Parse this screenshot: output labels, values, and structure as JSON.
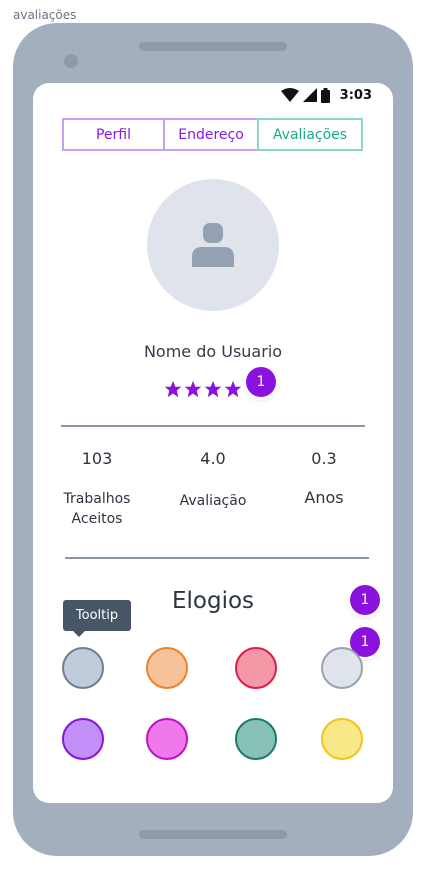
{
  "frame": {
    "label": "avaliações"
  },
  "status_bar": {
    "time": "3:03",
    "icons": [
      "wifi-icon",
      "signal-icon",
      "battery-icon"
    ]
  },
  "tabs": [
    {
      "label": "Perfil"
    },
    {
      "label": "Endereço"
    },
    {
      "label": "Avaliações",
      "active": true
    }
  ],
  "profile": {
    "avatar_icon": "user-icon",
    "name": "Nome do Usuario",
    "rating_stars": 4,
    "rating_badge": "1"
  },
  "stats": [
    {
      "value": "103",
      "label": "Trabalhos Aceitos"
    },
    {
      "value": "4.0",
      "label": "Avaliação"
    },
    {
      "value": "0.3",
      "label": "Anos"
    }
  ],
  "praise": {
    "title": "Elogios",
    "tooltip": "Tooltip",
    "badges": [
      "1",
      "1"
    ],
    "items": [
      {
        "fill": "#c0ccd9",
        "border": "#6f7e92"
      },
      {
        "fill": "#f7c29a",
        "border": "#ee822b"
      },
      {
        "fill": "#f497a6",
        "border": "#df1b4a"
      },
      {
        "fill": "#dfe4ec",
        "border": "#95a2b3"
      },
      {
        "fill": "#c18ff7",
        "border": "#8a12dc"
      },
      {
        "fill": "#ef78ea",
        "border": "#bf10c8"
      },
      {
        "fill": "#88c2b7",
        "border": "#1a7a66"
      },
      {
        "fill": "#f8e887",
        "border": "#f2c418"
      }
    ]
  },
  "colors": {
    "accent_purple": "#8a12dc",
    "accent_teal": "#19a98a",
    "star": "#8a12dc"
  }
}
